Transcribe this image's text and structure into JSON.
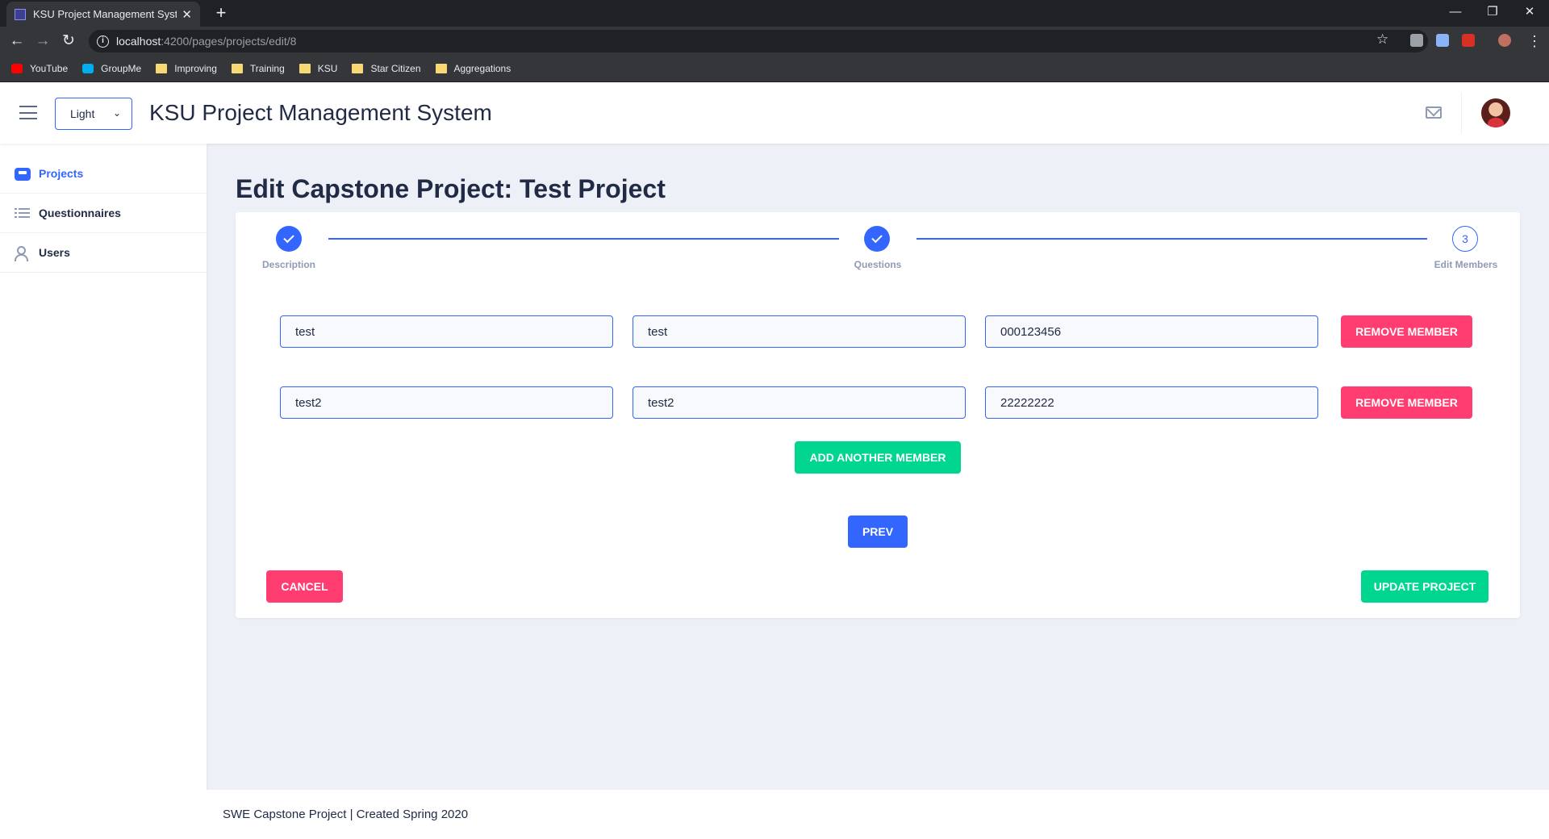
{
  "browser": {
    "tab_title": "KSU Project Management System",
    "new_tab": "+",
    "url_host": "localhost",
    "url_path": ":4200/pages/projects/edit/8",
    "bookmarks": [
      {
        "label": "YouTube",
        "icon": "youtube-icon"
      },
      {
        "label": "GroupMe",
        "icon": "groupme-icon"
      },
      {
        "label": "Improving",
        "icon": "folder-icon"
      },
      {
        "label": "Training",
        "icon": "folder-icon"
      },
      {
        "label": "KSU",
        "icon": "folder-icon"
      },
      {
        "label": "Star Citizen",
        "icon": "folder-icon"
      },
      {
        "label": "Aggregations",
        "icon": "folder-icon"
      }
    ]
  },
  "header": {
    "theme_value": "Light",
    "title": "KSU Project Management System"
  },
  "sidebar": {
    "items": [
      {
        "label": "Projects",
        "icon": "inbox-icon",
        "active": true
      },
      {
        "label": "Questionnaires",
        "icon": "list-icon",
        "active": false
      },
      {
        "label": "Users",
        "icon": "people-icon",
        "active": false
      }
    ]
  },
  "main": {
    "page_title": "Edit Capstone Project: Test Project",
    "stepper": {
      "steps": [
        {
          "label": "Description",
          "status": "complete"
        },
        {
          "label": "Questions",
          "status": "complete"
        },
        {
          "label": "Edit Members",
          "status": "current",
          "number": "3"
        }
      ]
    },
    "members": [
      {
        "first_name": "test",
        "last_name": "test",
        "id": "000123456",
        "remove_label": "Remove Member"
      },
      {
        "first_name": "test2",
        "last_name": "test2",
        "id": "22222222",
        "remove_label": "Remove Member"
      }
    ],
    "add_member_label": "Add Another Member",
    "prev_label": "Prev",
    "cancel_label": "Cancel",
    "update_label": "Update Project"
  },
  "footer": {
    "text": "SWE Capstone Project | Created Spring 2020"
  },
  "colors": {
    "primary": "#3366ff",
    "danger": "#ff3d71",
    "success": "#00d68f",
    "background": "#edf1f7"
  }
}
